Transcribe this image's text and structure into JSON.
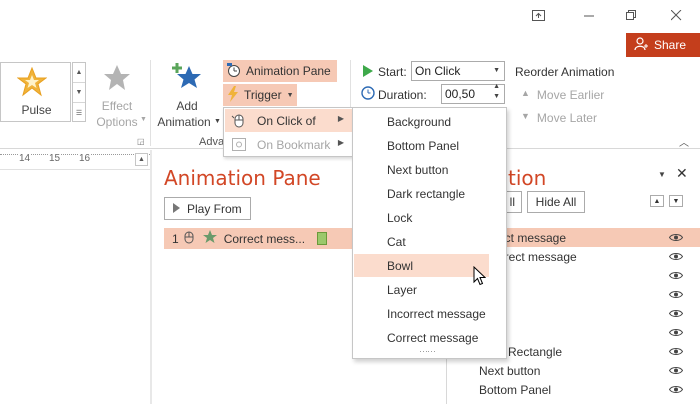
{
  "share": {
    "label": "Share"
  },
  "gallery": {
    "effect_label": "Pulse"
  },
  "ribbon": {
    "effect_options_line1": "Effect",
    "effect_options_line2": "Options",
    "add_animation_line1": "Add",
    "add_animation_line2": "Animation",
    "advanced_group_partial": "Adva",
    "animation_pane_label": "Animation Pane",
    "trigger_label": "Trigger",
    "start_label": "Start:",
    "start_value": "On Click",
    "duration_label": "Duration:",
    "duration_value": "00,50",
    "reorder_label": "Reorder Animation",
    "move_earlier_label": "Move Earlier",
    "move_later_label": "Move Later"
  },
  "ruler": {
    "ticks": [
      "14",
      "15",
      "16"
    ]
  },
  "trigger_menu": {
    "items": [
      {
        "label": "On Click of",
        "icon": "mouse-click-icon"
      },
      {
        "label": "On Bookmark",
        "icon": "bookmark-icon"
      }
    ]
  },
  "submenu": {
    "items": [
      "Background",
      "Bottom Panel",
      "Next button",
      "Dark rectangle",
      "Lock",
      "Cat",
      "Bowl",
      "Layer",
      "Incorrect message",
      "Correct message"
    ],
    "more_indicator": "⋯⋯"
  },
  "animation_pane": {
    "title": "Animation Pane",
    "play_from_label": "Play From",
    "items": [
      {
        "number": "1",
        "label": "Correct mess..."
      }
    ]
  },
  "selection_pane": {
    "title_partial": "tion",
    "show_all_partial": "ll",
    "hide_all_label": "Hide All",
    "rows": [
      {
        "label": "rrect message"
      },
      {
        "label": "orrect message"
      },
      {
        "label": ""
      },
      {
        "label": ""
      },
      {
        "label": ""
      },
      {
        "label": ""
      },
      {
        "label": "Rectangle"
      },
      {
        "label": "Next button"
      },
      {
        "label": "Bottom Panel"
      }
    ]
  },
  "colors": {
    "accent": "#d24726",
    "share_bg": "#c43e1c",
    "highlight": "#f6c9b5",
    "hover": "#fbdccd",
    "star_green": "#6a9a6a",
    "star_blue": "#2d6ab4"
  }
}
